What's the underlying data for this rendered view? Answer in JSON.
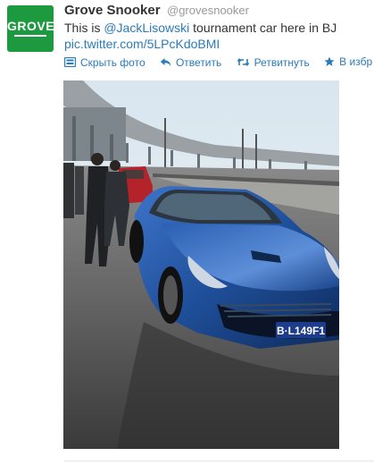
{
  "avatar": {
    "logo_text": "GROVE"
  },
  "tweet": {
    "name": "Grove Snooker",
    "handle": "@grovesnooker",
    "text_before": "This is ",
    "mention": "@JackLisowski",
    "text_after": " tournament car here in BJ",
    "link": "pic.twitter.com/5LPcKdoBMI"
  },
  "actions": [
    {
      "label": "Скрыть фото",
      "icon": "photo-icon"
    },
    {
      "label": "Ответить",
      "icon": "reply-icon"
    },
    {
      "label": "Ретвитнуть",
      "icon": "retweet-icon"
    },
    {
      "label": "В избр",
      "icon": "star-icon"
    }
  ],
  "photo": {
    "plate": "B·L149F1"
  },
  "colors": {
    "brand_green": "#1d9a3f",
    "link_blue": "#2b7bb9",
    "car_blue": "#1f4f9a"
  }
}
